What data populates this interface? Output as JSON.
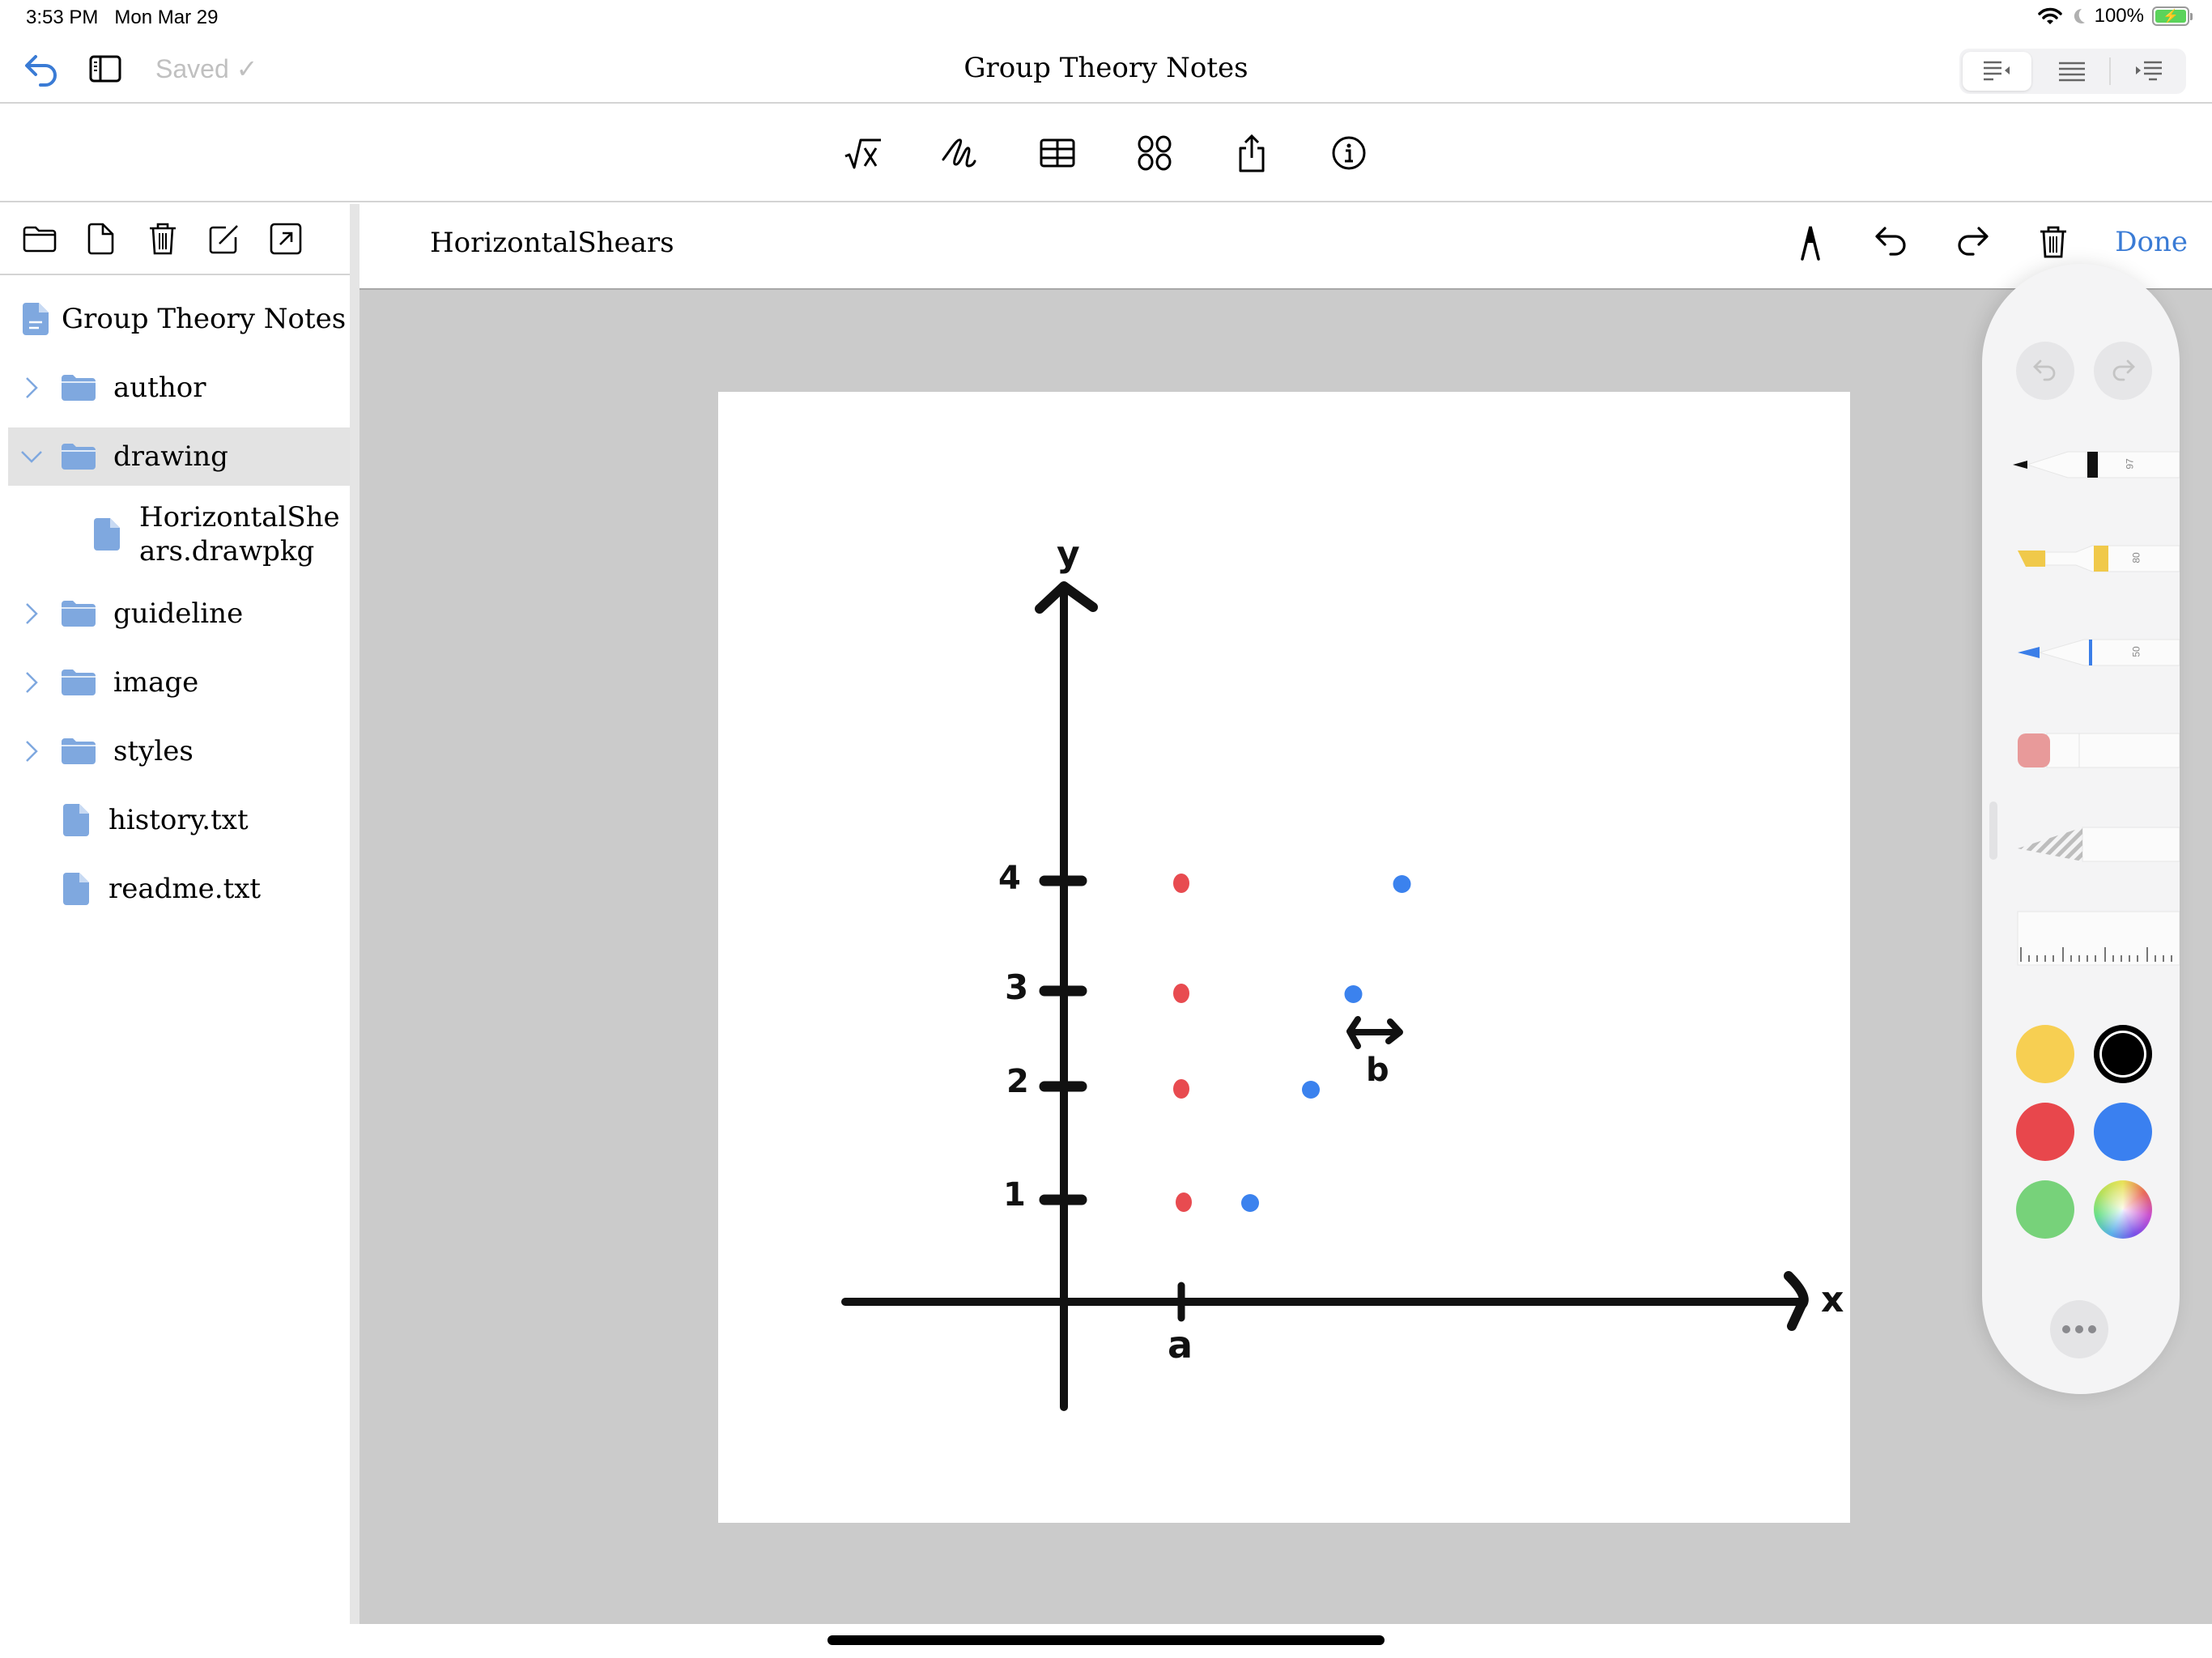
{
  "status_bar": {
    "time": "3:53 PM",
    "date": "Mon Mar 29",
    "battery": "100%",
    "icons": [
      "wifi-icon",
      "moon-icon",
      "battery-charging-icon"
    ]
  },
  "navbar": {
    "back_icon": "back-arrow-icon",
    "sidebar_icon": "sidebar-toggle-icon",
    "saved_label": "Saved ✓",
    "title": "Group Theory Notes",
    "alignment_options": [
      {
        "icon": "align-left-icon",
        "active": true
      },
      {
        "icon": "align-justify-icon",
        "active": false
      },
      {
        "icon": "align-right-icon",
        "active": false
      }
    ]
  },
  "toolbar": {
    "items": [
      {
        "icon": "math-formula-icon",
        "label": "√x"
      },
      {
        "icon": "scribble-icon"
      },
      {
        "icon": "table-icon"
      },
      {
        "icon": "grid-shapes-icon"
      },
      {
        "icon": "share-icon"
      },
      {
        "icon": "info-icon"
      }
    ]
  },
  "sidebar": {
    "actions": [
      "new-folder-icon",
      "new-file-icon",
      "trash-icon",
      "compose-icon",
      "open-external-icon"
    ],
    "tree": [
      {
        "label": "Group Theory Notes",
        "type": "document",
        "level": 0
      },
      {
        "label": "author",
        "type": "folder",
        "expanded": false,
        "level": 0
      },
      {
        "label": "drawing",
        "type": "folder",
        "expanded": true,
        "selected": true,
        "level": 0
      },
      {
        "label": "HorizontalShe",
        "label2": "ars.drawpkg",
        "type": "file",
        "level": 1
      },
      {
        "label": "guideline",
        "type": "folder",
        "expanded": false,
        "level": 0
      },
      {
        "label": "image",
        "type": "folder",
        "expanded": false,
        "level": 0
      },
      {
        "label": "styles",
        "type": "folder",
        "expanded": false,
        "level": 0
      },
      {
        "label": "history.txt",
        "type": "file",
        "level": 0
      },
      {
        "label": "readme.txt",
        "type": "file",
        "level": 0
      }
    ]
  },
  "canvas_header": {
    "title": "HorizontalShears",
    "tools": [
      "ruler-pen-icon",
      "undo-icon",
      "redo-icon",
      "trash-icon"
    ],
    "done_label": "Done"
  },
  "drawing": {
    "x_axis_label": "x",
    "y_axis_label": "y",
    "y_ticks": [
      "1",
      "2",
      "3",
      "4"
    ],
    "x_tick_label": "a",
    "shift_label": "b",
    "red_points": [
      [
        1,
        1
      ],
      [
        1,
        2
      ],
      [
        1,
        3
      ],
      [
        1,
        4
      ]
    ],
    "blue_points": [
      [
        1.6,
        1
      ],
      [
        2.1,
        2
      ],
      [
        2.45,
        3
      ],
      [
        2.85,
        4
      ]
    ],
    "red_color": "#e84b50",
    "blue_color": "#3b82ee",
    "ink_color": "#111111"
  },
  "palette": {
    "undo_icon": "undo-icon",
    "redo_icon": "redo-icon",
    "tools": [
      {
        "name": "pen",
        "value": "97",
        "color": "#111111"
      },
      {
        "name": "marker",
        "value": "80",
        "color": "#f0c94a"
      },
      {
        "name": "pencil",
        "value": "50",
        "color": "#3b7ee8"
      },
      {
        "name": "eraser"
      },
      {
        "name": "lasso"
      },
      {
        "name": "ruler"
      }
    ],
    "colors": [
      {
        "name": "yellow",
        "hex": "#f7cf52",
        "selected": false
      },
      {
        "name": "black",
        "hex": "#000000",
        "selected": true
      },
      {
        "name": "red",
        "hex": "#e8474c",
        "selected": false
      },
      {
        "name": "blue",
        "hex": "#3a80f0",
        "selected": false
      },
      {
        "name": "green",
        "hex": "#77d27a",
        "selected": false
      },
      {
        "name": "multicolor",
        "hex": "conic",
        "selected": false
      }
    ],
    "more_icon": "more-icon"
  },
  "accent_color": "#3a7bd5"
}
